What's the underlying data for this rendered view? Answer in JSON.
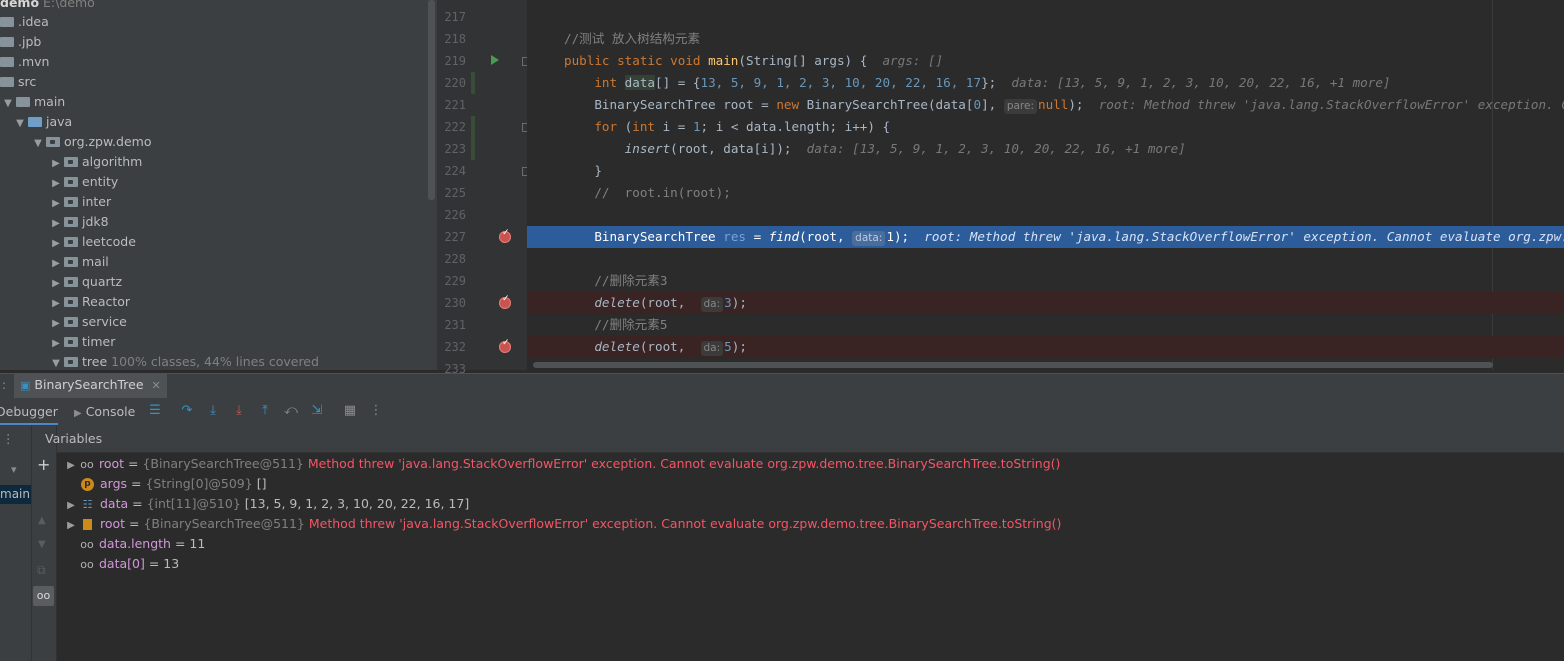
{
  "project": {
    "root": {
      "name": "demo",
      "path": "E:\\demo"
    },
    "items": [
      {
        "label": ".idea",
        "hint": ""
      },
      {
        "label": ".jpb",
        "hint": ""
      },
      {
        "label": ".mvn",
        "hint": ""
      },
      {
        "label": "src",
        "hint": ""
      },
      {
        "label": "main",
        "hint": ""
      },
      {
        "label": "java",
        "hint": ""
      },
      {
        "label": "org.zpw.demo",
        "hint": ""
      },
      {
        "label": "algorithm",
        "hint": ""
      },
      {
        "label": "entity",
        "hint": ""
      },
      {
        "label": "inter",
        "hint": ""
      },
      {
        "label": "jdk8",
        "hint": ""
      },
      {
        "label": "leetcode",
        "hint": ""
      },
      {
        "label": "mail",
        "hint": ""
      },
      {
        "label": "quartz",
        "hint": ""
      },
      {
        "label": "Reactor",
        "hint": ""
      },
      {
        "label": "service",
        "hint": ""
      },
      {
        "label": "timer",
        "hint": ""
      },
      {
        "label": "tree",
        "hint": "100% classes, 44% lines covered"
      }
    ]
  },
  "editor": {
    "line_numbers": [
      "217",
      "218",
      "219",
      "220",
      "221",
      "222",
      "223",
      "224",
      "225",
      "226",
      "227",
      "228",
      "229",
      "230",
      "231",
      "232",
      "233"
    ],
    "code": {
      "l218": "//测试 放入树结构元素",
      "l219_a": "public static void ",
      "l219_b": "main",
      "l219_c": "(String[] args) {  ",
      "l219_hint": "args: []",
      "l220_a": "    int ",
      "l220_b": "data",
      "l220_c": "[] = {",
      "l220_nums": "13, 5, 9, 1, 2, 3, 10, 20, 22, 16, 17",
      "l220_d": "};  ",
      "l220_hint": "data: [13, 5, 9, 1, 2, 3, 10, 20, 22, 16, +1 more]",
      "l221_a": "    BinarySearchTree root = ",
      "l221_new": "new ",
      "l221_b": "BinarySearchTree(data[",
      "l221_zero": "0",
      "l221_c": "], ",
      "l221_param": "pare:",
      "l221_null": "null",
      "l221_d": ");  ",
      "l221_hint": "root: Method threw 'java.lang.StackOverflowError' exception. Cannot evaluate org.zpw.demo.tree.BinarySearchTree.toString()",
      "l222_for": "    for ",
      "l222_a": "(",
      "l222_int": "int ",
      "l222_b": "i = ",
      "l222_one": "1",
      "l222_c": "; i < data.length; i++) {",
      "l223_a": "        ",
      "l223_fn": "insert",
      "l223_b": "(root, data[i]);  ",
      "l223_hint": "data: [13, 5, 9, 1, 2, 3, 10, 20, 22, 16, +1 more]",
      "l224": "    }",
      "l225": "    //  root.in(root);",
      "l227_a": "    BinarySearchTree ",
      "l227_res": "res",
      "l227_b": " = ",
      "l227_fn": "find",
      "l227_c": "(root, ",
      "l227_param": "data:",
      "l227_one": "1",
      "l227_d": ");  ",
      "l227_hint": "root: Method threw 'java.lang.StackOverflowError' exception. Cannot evaluate org.zpw.demo.tree.BinarySearchTree.toString()",
      "l229": "    //删除元素3",
      "l230_a": "    ",
      "l230_fn": "delete",
      "l230_b": "(root,  ",
      "l230_param": "da:",
      "l230_num": "3",
      "l230_c": ");",
      "l231": "    //删除元素5",
      "l232_a": "    ",
      "l232_fn": "delete",
      "l232_b": "(root,  ",
      "l232_param": "da:",
      "l232_num": "5",
      "l232_c": ");"
    }
  },
  "debug": {
    "tab_label": "BinarySearchTree",
    "debugger_label": "Debugger",
    "console_label": "Console",
    "variables_label": "Variables",
    "frame_label": "main:",
    "variables": [
      {
        "name": "root",
        "type": "{BinarySearchTree@511}",
        "value": "Method threw 'java.lang.StackOverflowError' exception. Cannot evaluate org.zpw.demo.tree.BinarySearchTree.toString()",
        "icon": "watch-icon"
      },
      {
        "name": "args",
        "type": "{String[0]@509}",
        "value": "[]",
        "icon": "parameter-icon"
      },
      {
        "name": "data",
        "type": "{int[11]@510}",
        "value": "[13, 5, 9, 1, 2, 3, 10, 20, 22, 16, 17]",
        "icon": "array-icon"
      },
      {
        "name": "root",
        "type": "{BinarySearchTree@511}",
        "value": "Method threw 'java.lang.StackOverflowError' exception. Cannot evaluate org.zpw.demo.tree.BinarySearchTree.toString()",
        "icon": "object-icon"
      },
      {
        "name": "data.length",
        "type": "",
        "value": "11",
        "icon": "watch-icon"
      },
      {
        "name": "data[0]",
        "type": "",
        "value": "13",
        "icon": "watch-icon"
      }
    ]
  },
  "colors": {
    "current_line": "#2d5c9b",
    "breakpoint": "#c75450",
    "error_text": "#f75464",
    "keyword": "#cc7832",
    "number": "#6897bb"
  }
}
